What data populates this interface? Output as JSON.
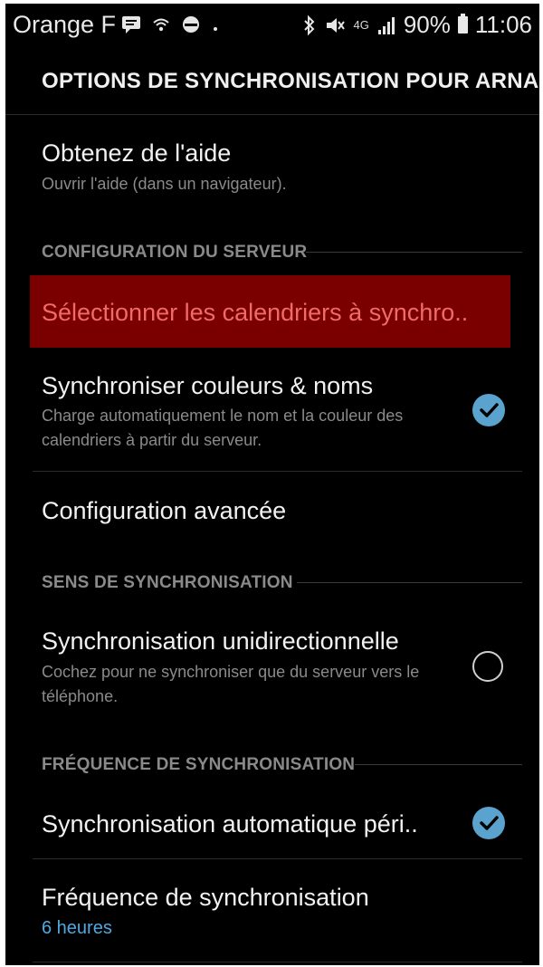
{
  "status_bar": {
    "carrier": "Orange F",
    "network": "4G",
    "battery": "90%",
    "time": "11:06",
    "icons": [
      "chat-icon",
      "wifi-icon",
      "sync-icon",
      "bluetooth-icon",
      "mute-icon",
      "signal-icon",
      "battery-icon"
    ]
  },
  "header": {
    "title": "OPTIONS DE SYNCHRONISATION POUR ARNAU…"
  },
  "help": {
    "title": "Obtenez de l'aide",
    "summary": "Ouvrir l'aide (dans un navigateur)."
  },
  "sections": {
    "server": "CONFIGURATION DU SERVEUR",
    "direction": "SENS DE SYNCHRONISATION",
    "frequency": "FRÉQUENCE DE SYNCHRONISATION"
  },
  "items": {
    "select_calendars": "Sélectionner les calendriers à synchro..",
    "sync_colors": {
      "title": "Synchroniser couleurs & noms",
      "summary": "Charge automatiquement le nom et la couleur des calendriers à partir du serveur.",
      "checked": true
    },
    "advanced": "Configuration avancée",
    "one_way": {
      "title": "Synchronisation unidirectionnelle",
      "summary": "Cochez pour ne synchroniser que du serveur vers le téléphone.",
      "checked": false
    },
    "auto_sync": {
      "title": "Synchronisation automatique péri..",
      "checked": true
    },
    "sync_frequency": {
      "title": "Fréquence de synchronisation",
      "value": "6 heures"
    }
  },
  "colors": {
    "background": "#000000",
    "highlight": "#7a0000",
    "highlight_text": "#f06a6a",
    "accent": "#5ba3cf",
    "value_blue": "#4fa9e0"
  }
}
